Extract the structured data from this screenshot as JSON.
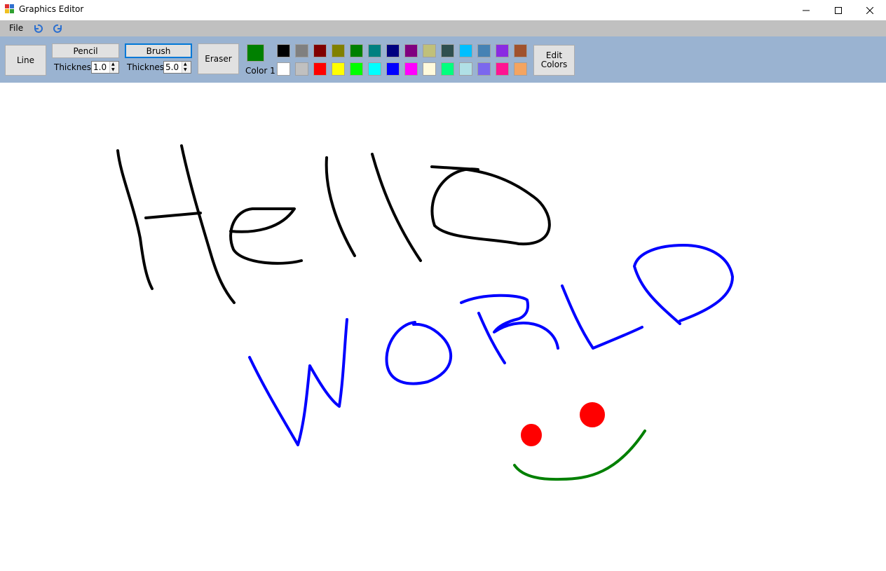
{
  "window": {
    "title": "Graphics Editor"
  },
  "menu": {
    "file": "File"
  },
  "toolbar": {
    "line_label": "Line",
    "pencil_label": "Pencil",
    "pencil_thickness_label": "Thickness",
    "pencil_thickness_value": "1.0",
    "brush_label": "Brush",
    "brush_thickness_label": "Thickness",
    "brush_thickness_value": "5.0",
    "eraser_label": "Eraser",
    "color1_label": "Color 1",
    "color1_value": "#008000",
    "edit_colors_label": "Edit\nColors",
    "palette_row1": [
      "#000000",
      "#808080",
      "#800000",
      "#808000",
      "#008000",
      "#008080",
      "#000080",
      "#800080",
      "#c0c07a",
      "#2f4f4f",
      "#00bfff",
      "#4682b4",
      "#8a2be2",
      "#a0522d"
    ],
    "palette_row2": [
      "#ffffff",
      "#c0c0c0",
      "#ff0000",
      "#ffff00",
      "#00ff00",
      "#00ffff",
      "#0000ff",
      "#ff00ff",
      "#fffadc",
      "#00ff7f",
      "#b0e0e6",
      "#7b68ee",
      "#ff1493",
      "#f4a460"
    ]
  },
  "canvas": {
    "stroke_colors": {
      "hello": "#000000",
      "world": "#0000ff",
      "eyes": "#ff0000",
      "smile": "#008000"
    }
  }
}
